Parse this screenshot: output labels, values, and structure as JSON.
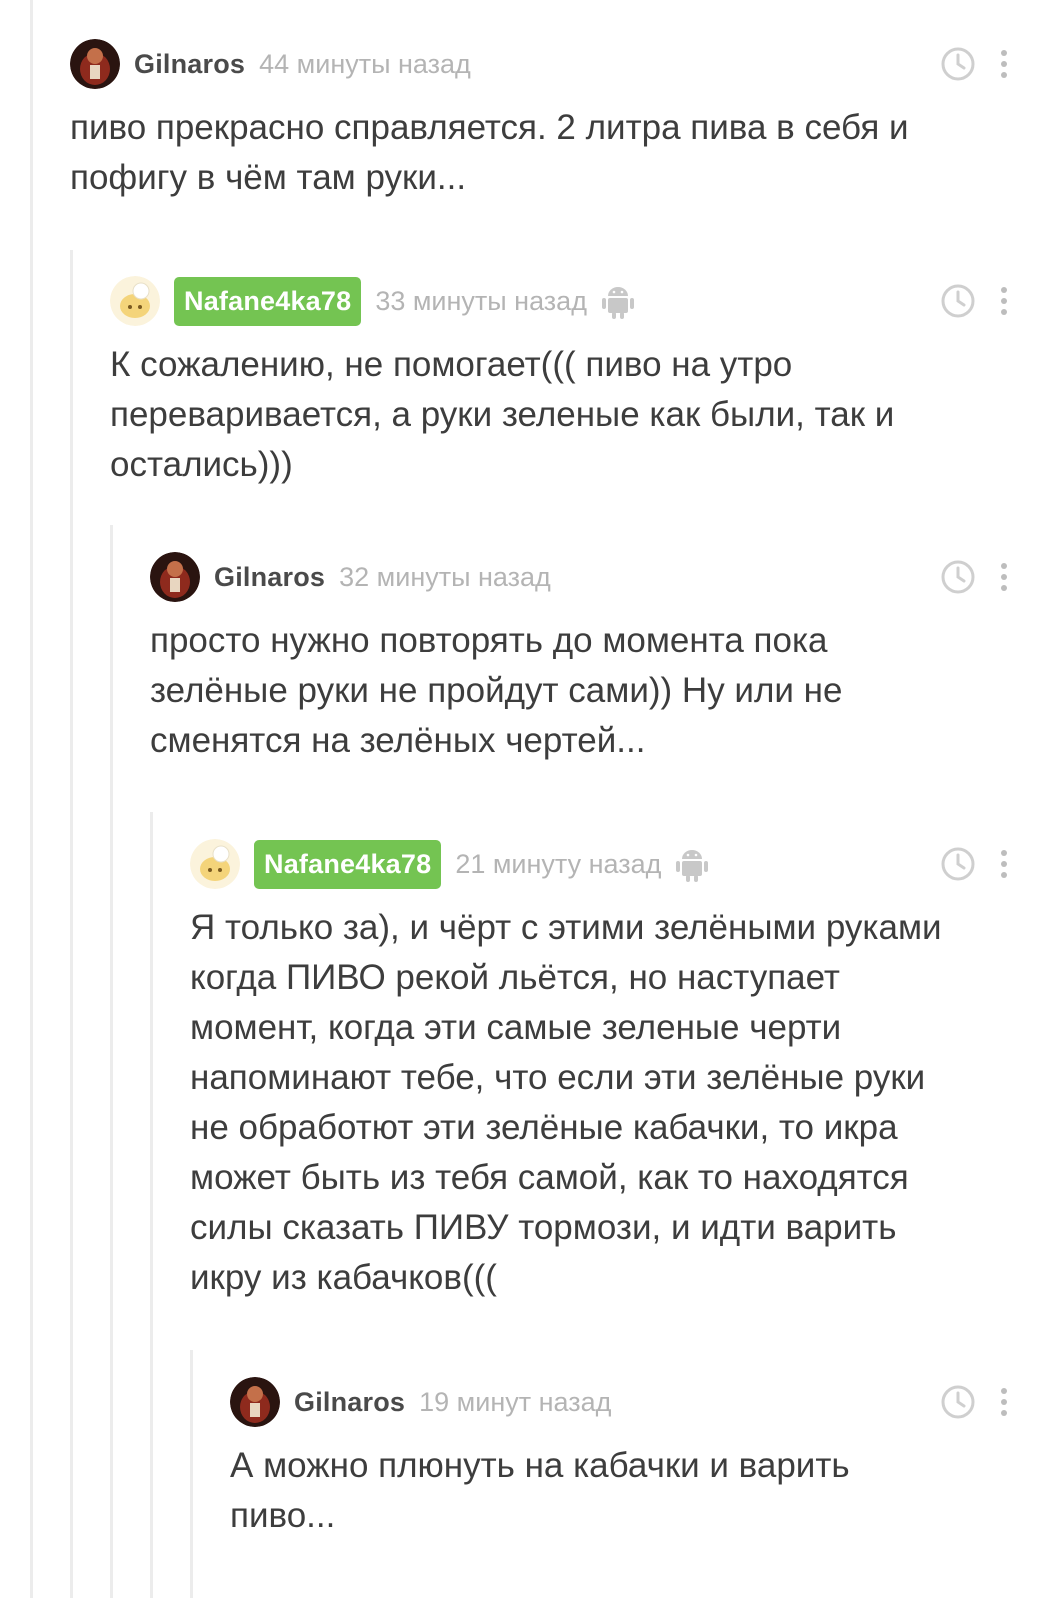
{
  "comments": [
    {
      "author": "Gilnaros",
      "time": "44 минуты назад",
      "text": "пиво прекрасно справляется. 2 литра пива в себя и\nпофигу в чём там руки..."
    },
    {
      "author": "Nafane4ka78",
      "time": "33 минуты назад",
      "text": "К сожалению, не помогает((( пиво на утро\nпереваривается, а руки зеленые как были, так и\nостались)))"
    },
    {
      "author": "Gilnaros",
      "time": "32 минуты назад",
      "text": "просто нужно повторять до момента пока\nзелёные руки не пройдут сами)) Ну или не\nсменятся на зелёных чертей..."
    },
    {
      "author": "Nafane4ka78",
      "time": "21 минуту назад",
      "text": "Я только за), и чёрт с этими зелёными руками\nкогда ПИВО рекой льётся, но наступает\nмомент, когда эти самые зеленые черти\nнапоминают тебе, что если эти зелёные руки\nне обработют эти зелёные кабачки, то икра\nможет быть из тебя самой, как то находятся\nсилы сказать ПИВУ тормози, и идти варить\nикру из кабачков((("
    },
    {
      "author": "Gilnaros",
      "time": "19 минут назад",
      "text": "А можно плюнуть на кабачки и варить\nпиво..."
    }
  ],
  "colors": {
    "badge": "#74c452",
    "thread": "#ececec",
    "meta": "#b4b4b4"
  }
}
